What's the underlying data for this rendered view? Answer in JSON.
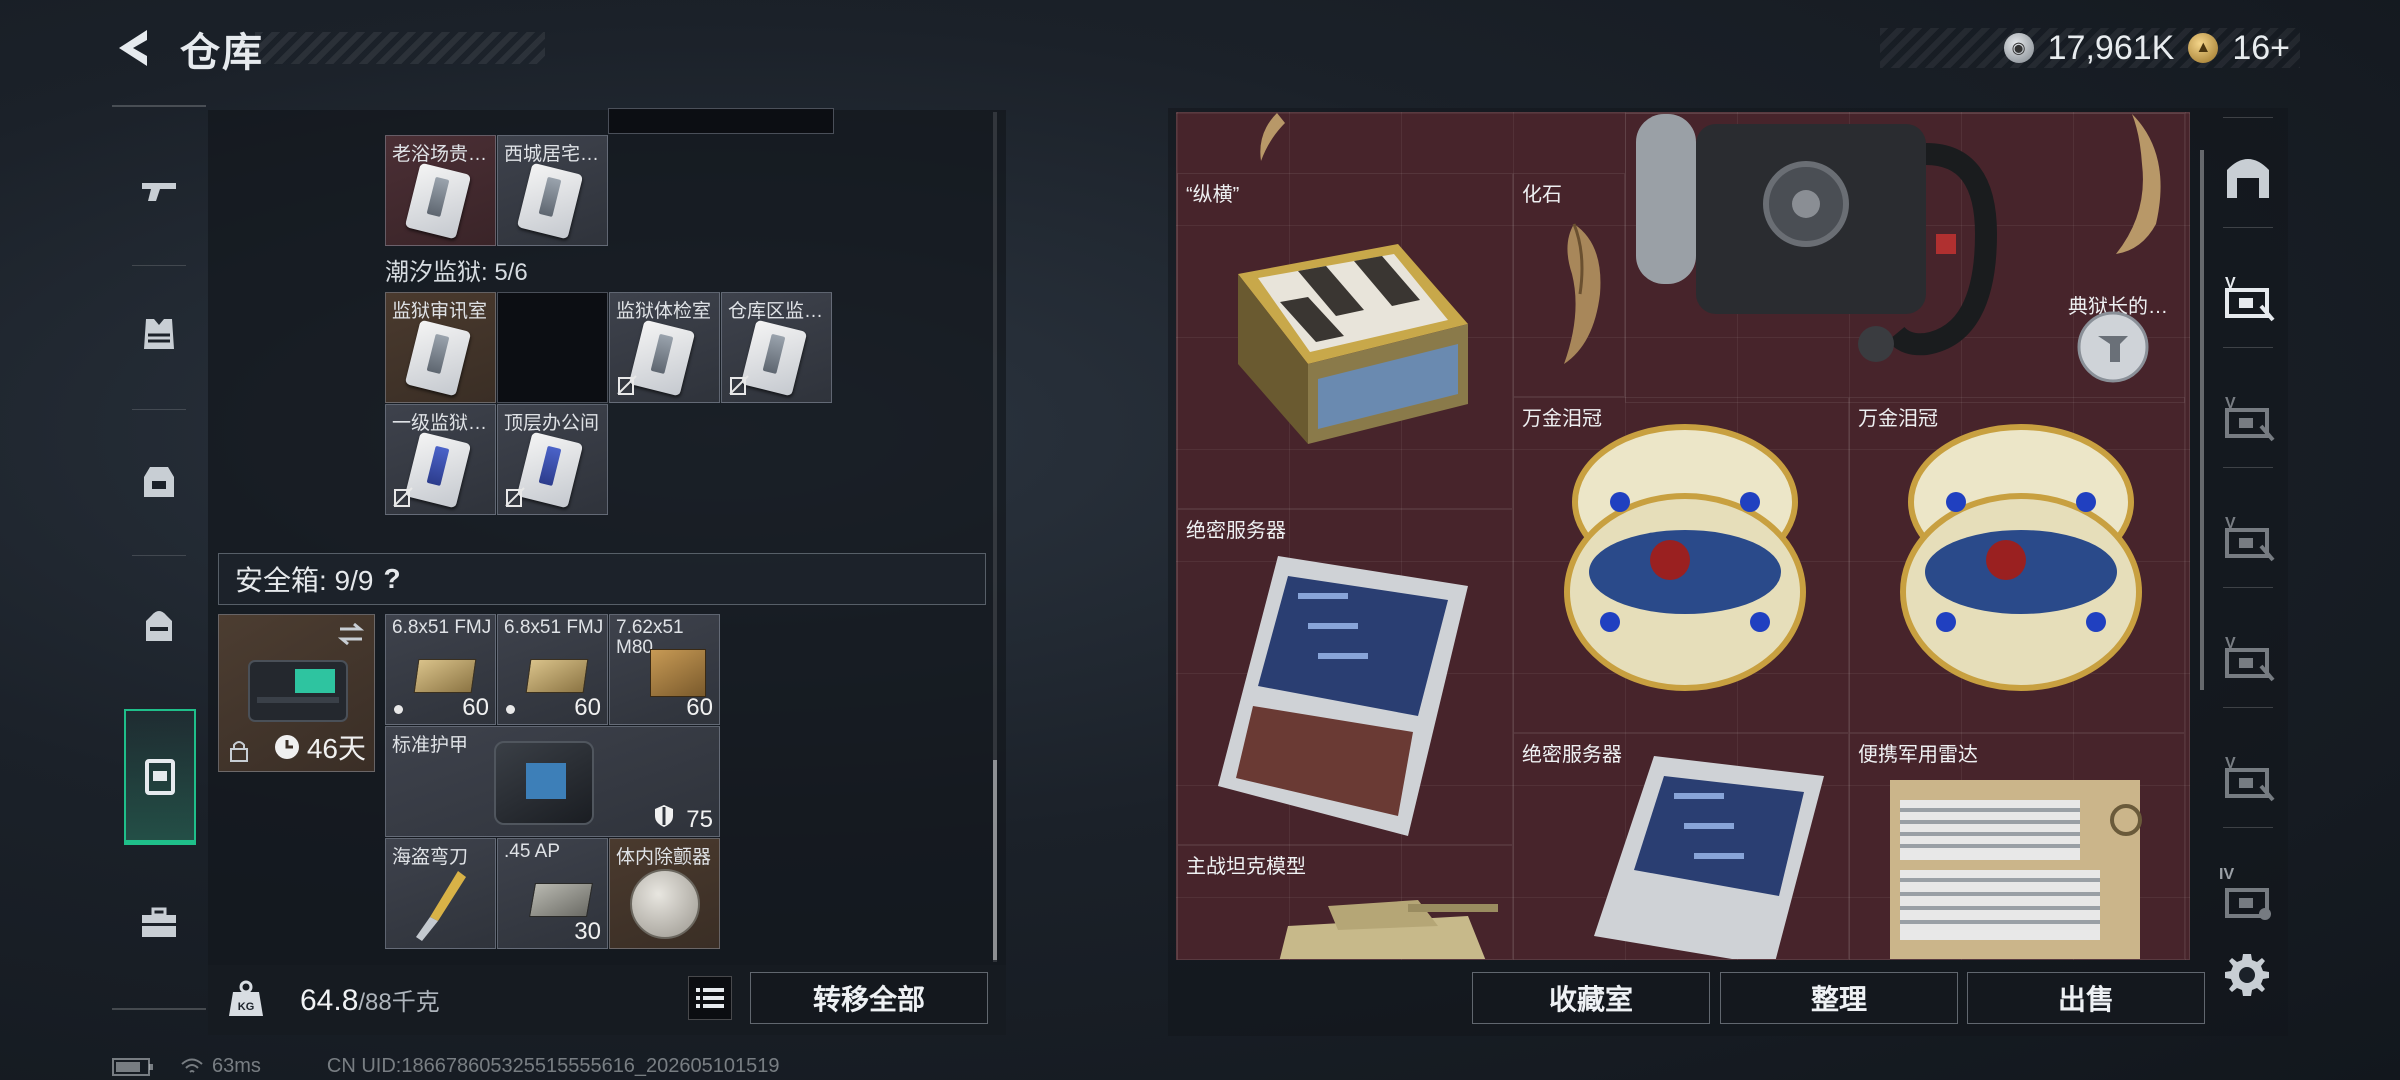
{
  "header": {
    "title": "仓库",
    "currency_silver": "17,961K",
    "currency_gold": "16+"
  },
  "left_sidebar": {
    "tabs": [
      "weapons-icon",
      "vest-icon",
      "backpack-icon",
      "bag-icon",
      "container-icon",
      "toolbox-icon"
    ],
    "active_tab": 4
  },
  "storage": {
    "top_row_labels": [
      "老浴场贵…",
      "西城居宅…"
    ],
    "prison_heading": "潮汐监狱: 5/6",
    "prison_cards": [
      {
        "label": "监狱审讯室"
      },
      {
        "label": ""
      },
      {
        "label": "监狱体检室"
      },
      {
        "label": "仓库区监…"
      },
      {
        "label": "一级监狱…"
      },
      {
        "label": "顶层办公间"
      }
    ],
    "safebox_title": "安全箱: 9/9",
    "safebox_help": "?",
    "safe_timer": "46天",
    "safe_items": [
      {
        "label": "6.8x51 FMJ",
        "qty": "60"
      },
      {
        "label": "6.8x51 FMJ",
        "qty": "60"
      },
      {
        "label": "7.62x51 M80",
        "qty": "60"
      },
      {
        "label": "标准护甲",
        "qty": "75"
      },
      {
        "label": "海盗弯刀",
        "qty": ""
      },
      {
        "label": ".45 AP",
        "qty": "30"
      },
      {
        "label": "体内除颤器",
        "qty": ""
      }
    ],
    "weight_current": "64.8",
    "weight_max": "/88千克",
    "transfer_all": "转移全部"
  },
  "collection": {
    "items": [
      {
        "label": "“纵横”"
      },
      {
        "label": "化石"
      },
      {
        "label": "典狱长的…"
      },
      {
        "label": "万金泪冠"
      },
      {
        "label": "万金泪冠"
      },
      {
        "label": "绝密服务器"
      },
      {
        "label": "绝密服务器"
      },
      {
        "label": "便携军用雷达"
      },
      {
        "label": "主战坦克模型"
      }
    ],
    "buttons": {
      "vault": "收藏室",
      "sort": "整理",
      "sell": "出售"
    }
  },
  "right_tabs": {
    "items": [
      "home-icon",
      "case-1-icon",
      "case-2-icon",
      "case-3-icon",
      "case-4-icon",
      "case-5-icon",
      "case-4-level-icon"
    ],
    "case_4_label": "IV"
  },
  "status": {
    "ping": "63ms",
    "uid": "CN UID:18667860532551555561​6_202605101519"
  }
}
